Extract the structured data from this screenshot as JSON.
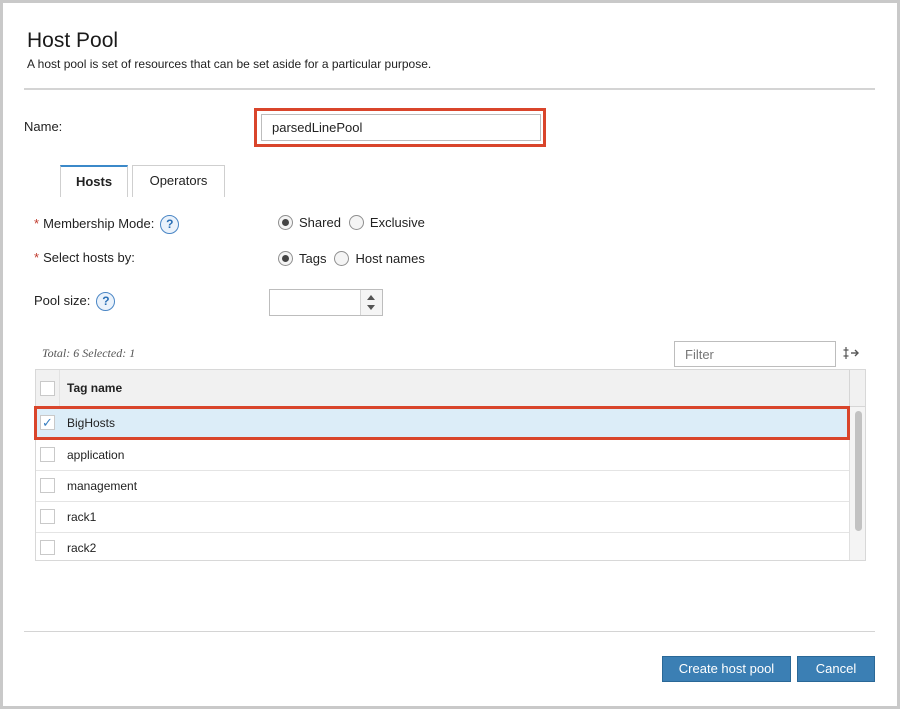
{
  "dialog": {
    "title": "Host Pool",
    "subtitle": "A host pool is set of resources that can be set aside for a particular purpose."
  },
  "name": {
    "label": "Name:",
    "value": "parsedLinePool"
  },
  "tabs": [
    {
      "label": "Hosts",
      "active": true
    },
    {
      "label": "Operators",
      "active": false
    }
  ],
  "membership": {
    "label": "Membership Mode:",
    "required": "*",
    "help_icon": "?",
    "options": [
      {
        "label": "Shared",
        "selected": true
      },
      {
        "label": "Exclusive",
        "selected": false
      }
    ]
  },
  "select_hosts": {
    "label": "Select hosts by:",
    "required": "*",
    "options": [
      {
        "label": "Tags",
        "selected": true
      },
      {
        "label": "Host names",
        "selected": false
      }
    ]
  },
  "pool_size": {
    "label": "Pool size:",
    "help_icon": "?",
    "value": ""
  },
  "table": {
    "summary": "Total: 6 Selected: 1",
    "filter_placeholder": "Filter",
    "column_header": "Tag name",
    "rows": [
      {
        "name": "BigHosts",
        "checked": true
      },
      {
        "name": "application",
        "checked": false
      },
      {
        "name": "management",
        "checked": false
      },
      {
        "name": "rack1",
        "checked": false
      },
      {
        "name": "rack2",
        "checked": false
      }
    ]
  },
  "buttons": {
    "create": "Create host pool",
    "cancel": "Cancel"
  },
  "icons": {
    "check": "✓",
    "column_settings": "column-settings-icon"
  },
  "colors": {
    "accent": "#3b7fb4",
    "highlight": "#d9452b",
    "selected_row": "#dcedf8"
  }
}
